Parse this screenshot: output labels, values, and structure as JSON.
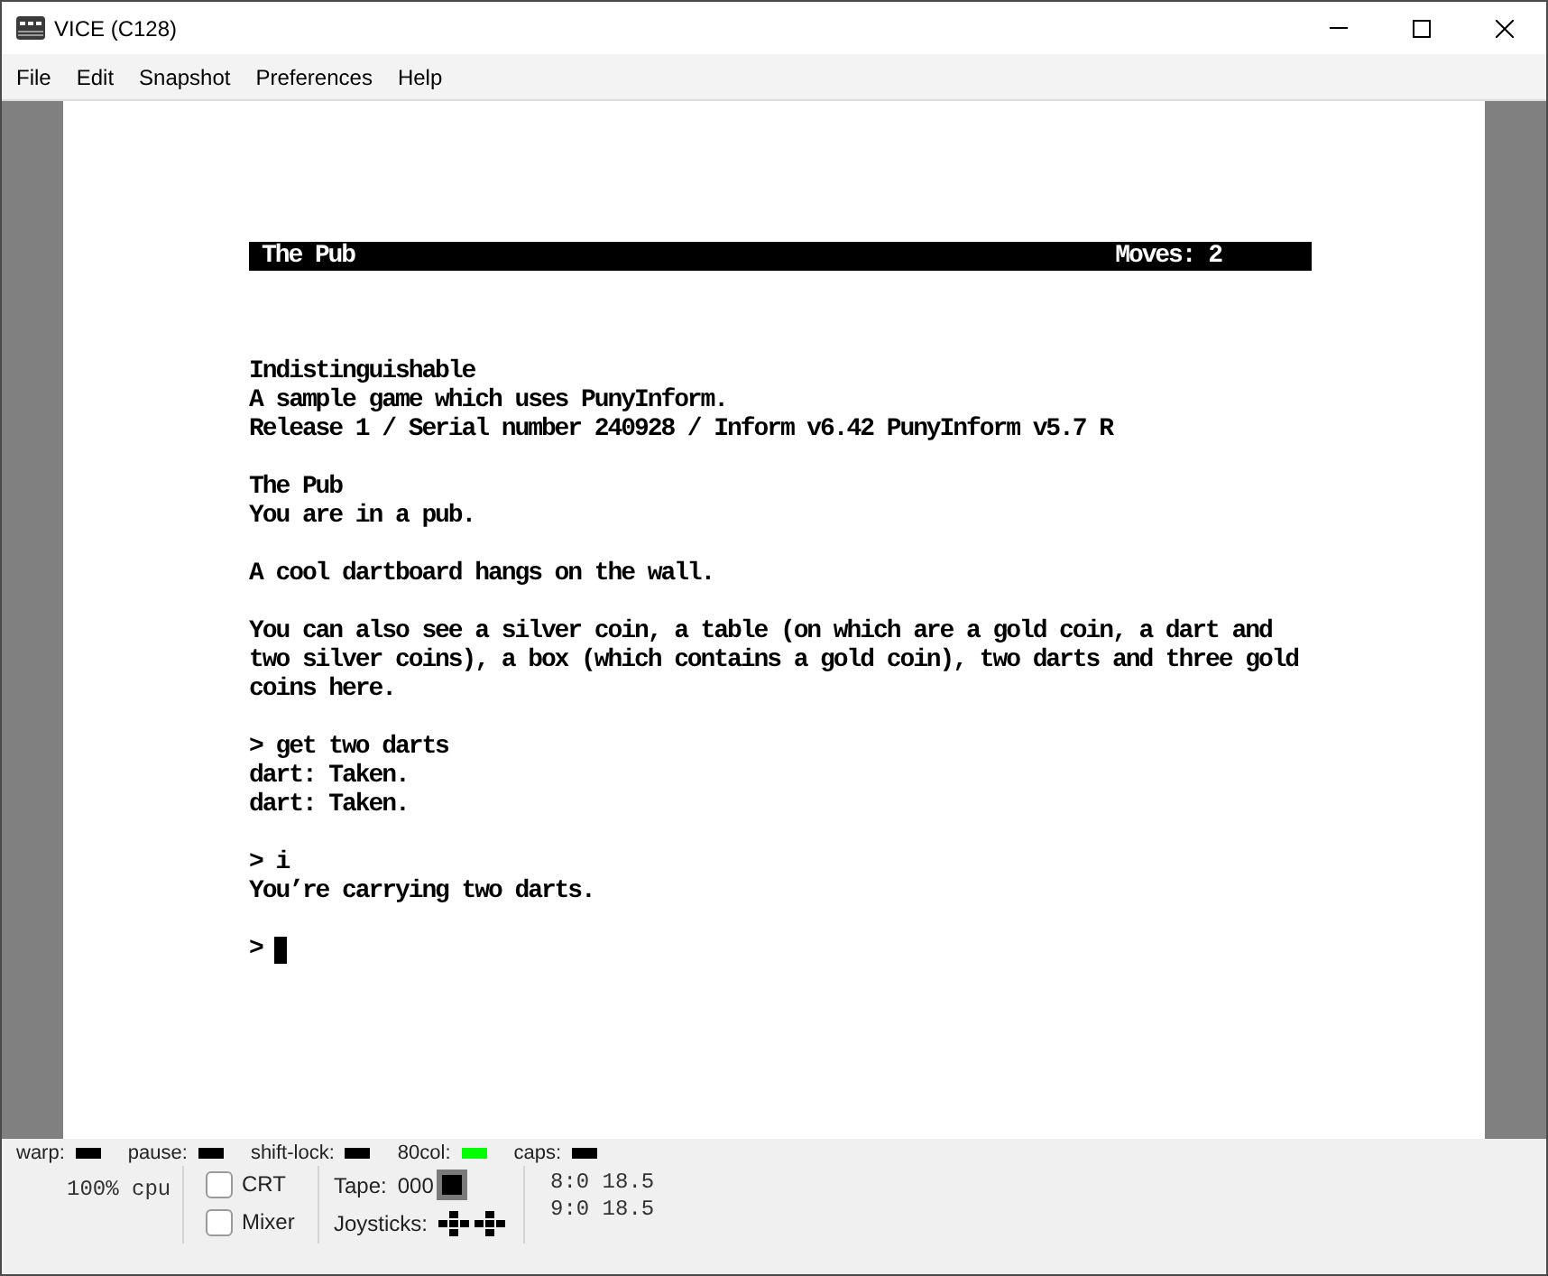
{
  "window": {
    "title": "VICE (C128)"
  },
  "menu": [
    "File",
    "Edit",
    "Snapshot",
    "Preferences",
    "Help"
  ],
  "screen": {
    "status_line": {
      "location": "The Pub",
      "moves": "Moves: 2"
    },
    "paragraphs": [
      [
        "Indistinguishable",
        "A sample game which uses PunyInform.",
        "Release 1 / Serial number 240928 / Inform v6.42 PunyInform v5.7 R"
      ],
      [
        "The Pub",
        "You are in a pub."
      ],
      [
        "A cool dartboard hangs on the wall."
      ],
      [
        "You can also see a silver coin, a table (on which are a gold coin, a dart and",
        "two silver coins), a box (which contains a gold coin), two darts and three gold",
        "coins here."
      ],
      [
        "> get two darts",
        "dart: Taken.",
        "dart: Taken."
      ],
      [
        "> i",
        "You’re carrying two darts."
      ]
    ],
    "prompt": {
      "text": ">",
      "cursor": true
    }
  },
  "status_bar": {
    "indicators": [
      {
        "label": "warp:",
        "on": false
      },
      {
        "label": "pause:",
        "on": false
      },
      {
        "label": "shift-lock:",
        "on": false
      },
      {
        "label": "80col:",
        "on": true
      },
      {
        "label": "caps:",
        "on": false
      }
    ],
    "cpu": "100% cpu",
    "checkboxes": [
      {
        "label": "CRT",
        "checked": false
      },
      {
        "label": "Mixer",
        "checked": false
      }
    ],
    "tape": {
      "label": "Tape:",
      "counter": "000"
    },
    "joysticks": {
      "label": "Joysticks:"
    },
    "drives": [
      "8:0 18.5",
      "9:0 18.5"
    ]
  }
}
